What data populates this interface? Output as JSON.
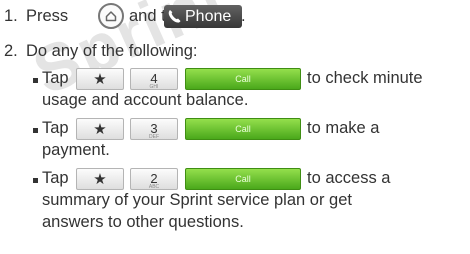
{
  "watermark": "Sprint",
  "step1": {
    "num": "1.",
    "text_a": "Press",
    "text_b": "and tap",
    "home_icon": "home-icon",
    "phone_label": "Phone",
    "phone_icon": "phone-handset-icon",
    "period": "."
  },
  "step2": {
    "num": "2.",
    "text": "Do any of the following:"
  },
  "items": [
    {
      "tap": "Tap",
      "star": "★",
      "digit": "4",
      "letters": "GHI",
      "call": "Call",
      "line1": "to check minute",
      "line2": "usage and account balance."
    },
    {
      "tap": "Tap",
      "star": "★",
      "digit": "3",
      "letters": "DEF",
      "call": "Call",
      "line1": "to make a",
      "line2": "payment."
    },
    {
      "tap": "Tap",
      "star": "★",
      "digit": "2",
      "letters": "ABC",
      "call": "Call",
      "line1": "to access a",
      "line2": "summary of your Sprint service plan or get",
      "line3": "answers to other questions."
    }
  ],
  "colors": {
    "text": "#333333",
    "call_green": "#5cbf2a",
    "phone_bg": "#3c3c3c",
    "watermark": "#e4e4e4"
  }
}
